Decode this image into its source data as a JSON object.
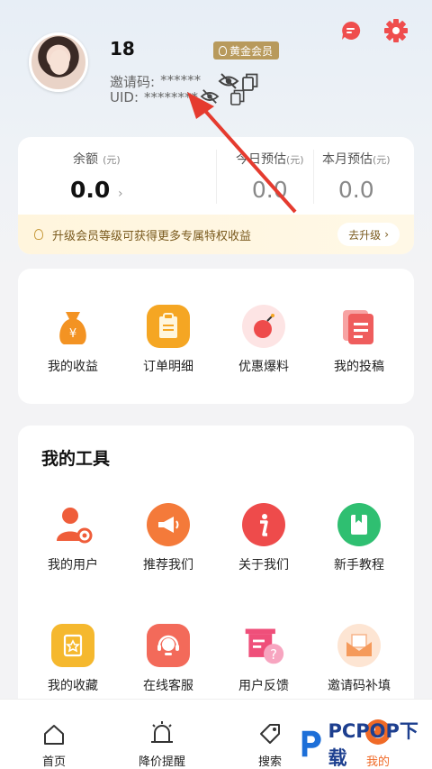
{
  "header": {
    "username": "18",
    "badge": "黄金会员",
    "invite_label": "邀请码:",
    "invite_value": "******",
    "uid_label": "UID:",
    "uid_value": "********"
  },
  "balance": {
    "main_label": "余额",
    "main_unit": "(元)",
    "main_value": "0.0",
    "today_label": "今日预估",
    "today_unit": "(元)",
    "today_value": "0.0",
    "month_label": "本月预估",
    "month_unit": "(元)",
    "month_value": "0.0",
    "promo_text": "升级会员等级可获得更多专属特权收益",
    "upgrade_label": "去升级"
  },
  "quick": [
    {
      "label": "我的收益",
      "icon": "money-bag-icon"
    },
    {
      "label": "订单明细",
      "icon": "clipboard-icon"
    },
    {
      "label": "优惠爆料",
      "icon": "bomb-icon"
    },
    {
      "label": "我的投稿",
      "icon": "document-icon"
    }
  ],
  "tools": {
    "title": "我的工具",
    "items": [
      {
        "label": "我的用户",
        "icon": "user-gear-icon"
      },
      {
        "label": "推荐我们",
        "icon": "megaphone-icon"
      },
      {
        "label": "关于我们",
        "icon": "info-icon"
      },
      {
        "label": "新手教程",
        "icon": "book-icon"
      },
      {
        "label": "我的收藏",
        "icon": "favorite-icon"
      },
      {
        "label": "在线客服",
        "icon": "headset-icon"
      },
      {
        "label": "用户反馈",
        "icon": "feedback-icon"
      },
      {
        "label": "邀请码补填",
        "icon": "envelope-icon"
      }
    ]
  },
  "nav": {
    "home": "首页",
    "price_alert": "降价提醒",
    "search": "搜索",
    "mine": "我的"
  },
  "watermark": "PCPOP下载",
  "colors": {
    "accent": "#f06a27",
    "gold_badge": "#b89a5c",
    "green": "#2fbf71",
    "red": "#ee4b4b"
  }
}
